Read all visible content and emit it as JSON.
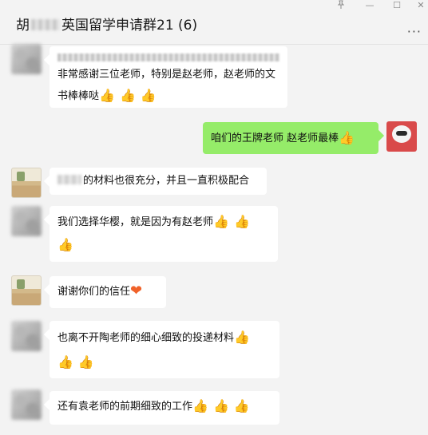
{
  "window": {
    "title_prefix": "胡",
    "title": "英国留学申请群21 (6)",
    "pin_icon": "pin-icon",
    "minimize_glyph": "—",
    "maximize_glyph": "☐",
    "close_glyph": "✕",
    "more_glyph": "···"
  },
  "messages": [
    {
      "sender": "other",
      "text": "非常感谢三位老师，特别是赵老师，赵老师的文书棒棒哒",
      "emoji": "👍"
    },
    {
      "sender": "self",
      "text": "咱们的王牌老师 赵老师最棒",
      "emoji": "👍"
    },
    {
      "sender": "other",
      "text": "的材料也很充分，并且一直积极配合"
    },
    {
      "sender": "other",
      "text": "我们选择华樱，就是因为有赵老师",
      "emoji": "👍"
    },
    {
      "sender": "other",
      "text": "谢谢你们的信任",
      "emoji": "❤"
    },
    {
      "sender": "other",
      "text": "也离不开陶老师的细心细致的投递材料",
      "emoji": "👍"
    },
    {
      "sender": "other",
      "text": "还有袁老师的前期细致的工作",
      "emoji": "👍"
    }
  ],
  "colors": {
    "self_bubble": "#95ec69",
    "other_bubble": "#ffffff",
    "background": "#f3f3f3"
  }
}
